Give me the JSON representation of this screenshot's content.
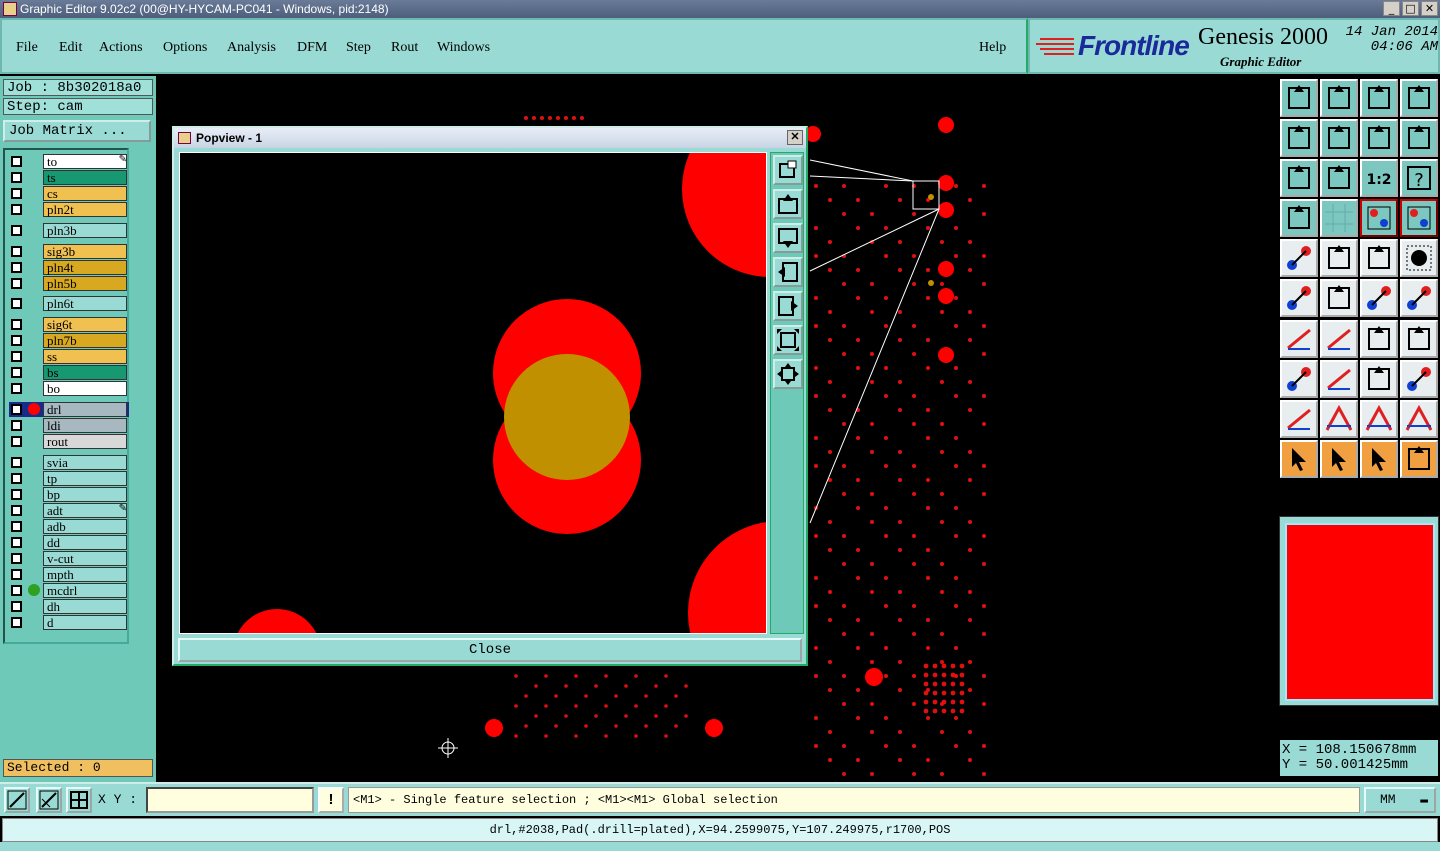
{
  "window": {
    "title": "Graphic Editor 9.02c2 (00@HY-HYCAM-PC041 - Windows, pid:2148)",
    "min": "_",
    "max": "□",
    "close": "✕"
  },
  "menu": {
    "items": [
      "File",
      "Edit",
      "Actions",
      "Options",
      "Analysis",
      "DFM",
      "Step",
      "Rout",
      "Windows"
    ],
    "help": "Help"
  },
  "brand": {
    "logo": "Frontline",
    "product": "Genesis 2000",
    "subtitle": "Graphic Editor",
    "date": "14 Jan 2014",
    "time": "04:06 AM"
  },
  "job": {
    "job_label": "Job : 8b302018a0",
    "step_label": "Step: cam",
    "matrix_button": "Job Matrix ..."
  },
  "layers": [
    {
      "name": "to",
      "color": "#ffffff",
      "edit": true
    },
    {
      "name": "ts",
      "color": "#189870"
    },
    {
      "name": "cs",
      "color": "#f0c050"
    },
    {
      "name": "pln2t",
      "color": "#f0c050"
    },
    {
      "name": "pln3b",
      "color": "#99dad4"
    },
    {
      "name": "sig3b",
      "color": "#f0c050"
    },
    {
      "name": "pln4t",
      "color": "#d8a820"
    },
    {
      "name": "pln5b",
      "color": "#d8a820"
    },
    {
      "name": "pln6t",
      "color": "#99dad4"
    },
    {
      "name": "sig6t",
      "color": "#f0c050"
    },
    {
      "name": "pln7b",
      "color": "#d8a820"
    },
    {
      "name": "ss",
      "color": "#f0c050"
    },
    {
      "name": "bs",
      "color": "#189870"
    },
    {
      "name": "bo",
      "color": "#ffffff"
    },
    {
      "name": "drl",
      "color": "#a8b8c0",
      "dot": "#ff0000",
      "active": true
    },
    {
      "name": "ldi",
      "color": "#a8b8c0"
    },
    {
      "name": "rout",
      "color": "#d8d8d8"
    },
    {
      "name": "svia",
      "color": "#99dad4"
    },
    {
      "name": "tp",
      "color": "#99dad4"
    },
    {
      "name": "bp",
      "color": "#99dad4"
    },
    {
      "name": "adt",
      "color": "#99dad4",
      "edit": true
    },
    {
      "name": "adb",
      "color": "#99dad4"
    },
    {
      "name": "dd",
      "color": "#99dad4"
    },
    {
      "name": "v-cut",
      "color": "#99dad4"
    },
    {
      "name": "mpth",
      "color": "#99dad4"
    },
    {
      "name": "mcdrl",
      "color": "#99dad4",
      "dot": "#30a020"
    },
    {
      "name": "dh",
      "color": "#99dad4"
    },
    {
      "name": "d",
      "color": "#99dad4"
    }
  ],
  "selected_label": "Selected : 0",
  "popview": {
    "title": "Popview - 1",
    "close_button": "Close",
    "close_x": "✕"
  },
  "coords": {
    "x": "X = 108.150678mm",
    "y": "Y = 50.001425mm"
  },
  "bottom": {
    "xy_label": "X Y :",
    "xy_value": "",
    "excl": "!",
    "message": "<M1> - Single feature selection ; <M1><M1> Global selection",
    "units": "MM"
  },
  "status": "drl,#2038,Pad(.drill=plated),X=94.2599075,Y=107.249975,r1700,POS",
  "colors": {
    "panel": "#99dad4",
    "accent": "#6ec9b8",
    "pad": "#ff0000",
    "drill": "#c09000"
  }
}
